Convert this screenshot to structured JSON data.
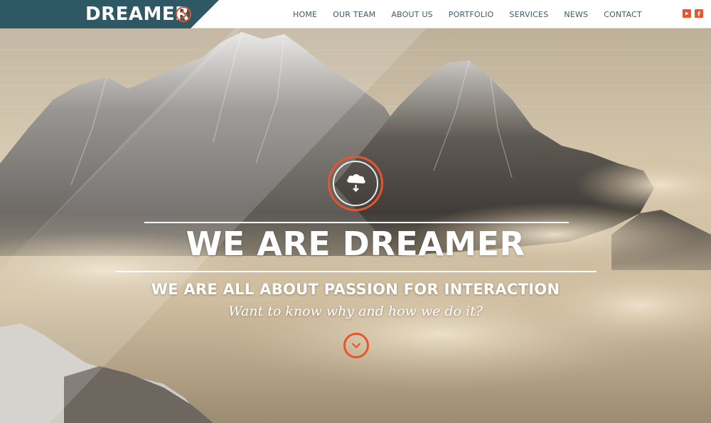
{
  "brand": {
    "name": "DREAMER",
    "accent_color": "#e8542b",
    "logo_block_color": "#2d5864",
    "logo_icon": "chevron-right-circle-icon"
  },
  "nav": {
    "items": [
      "HOME",
      "OUR TEAM",
      "ABOUT US",
      "PORTFOLIO",
      "SERVICES",
      "NEWS",
      "CONTACT"
    ]
  },
  "social": {
    "icons": [
      "youtube-icon",
      "facebook-icon"
    ]
  },
  "hero": {
    "badge_icon": "cloud-download-icon",
    "headline": "WE ARE DREAMER",
    "subheadline": "WE ARE ALL ABOUT PASSION FOR INTERACTION",
    "tagline": "Want to know why and how we do it?",
    "scroll_icon": "chevron-down-icon"
  }
}
